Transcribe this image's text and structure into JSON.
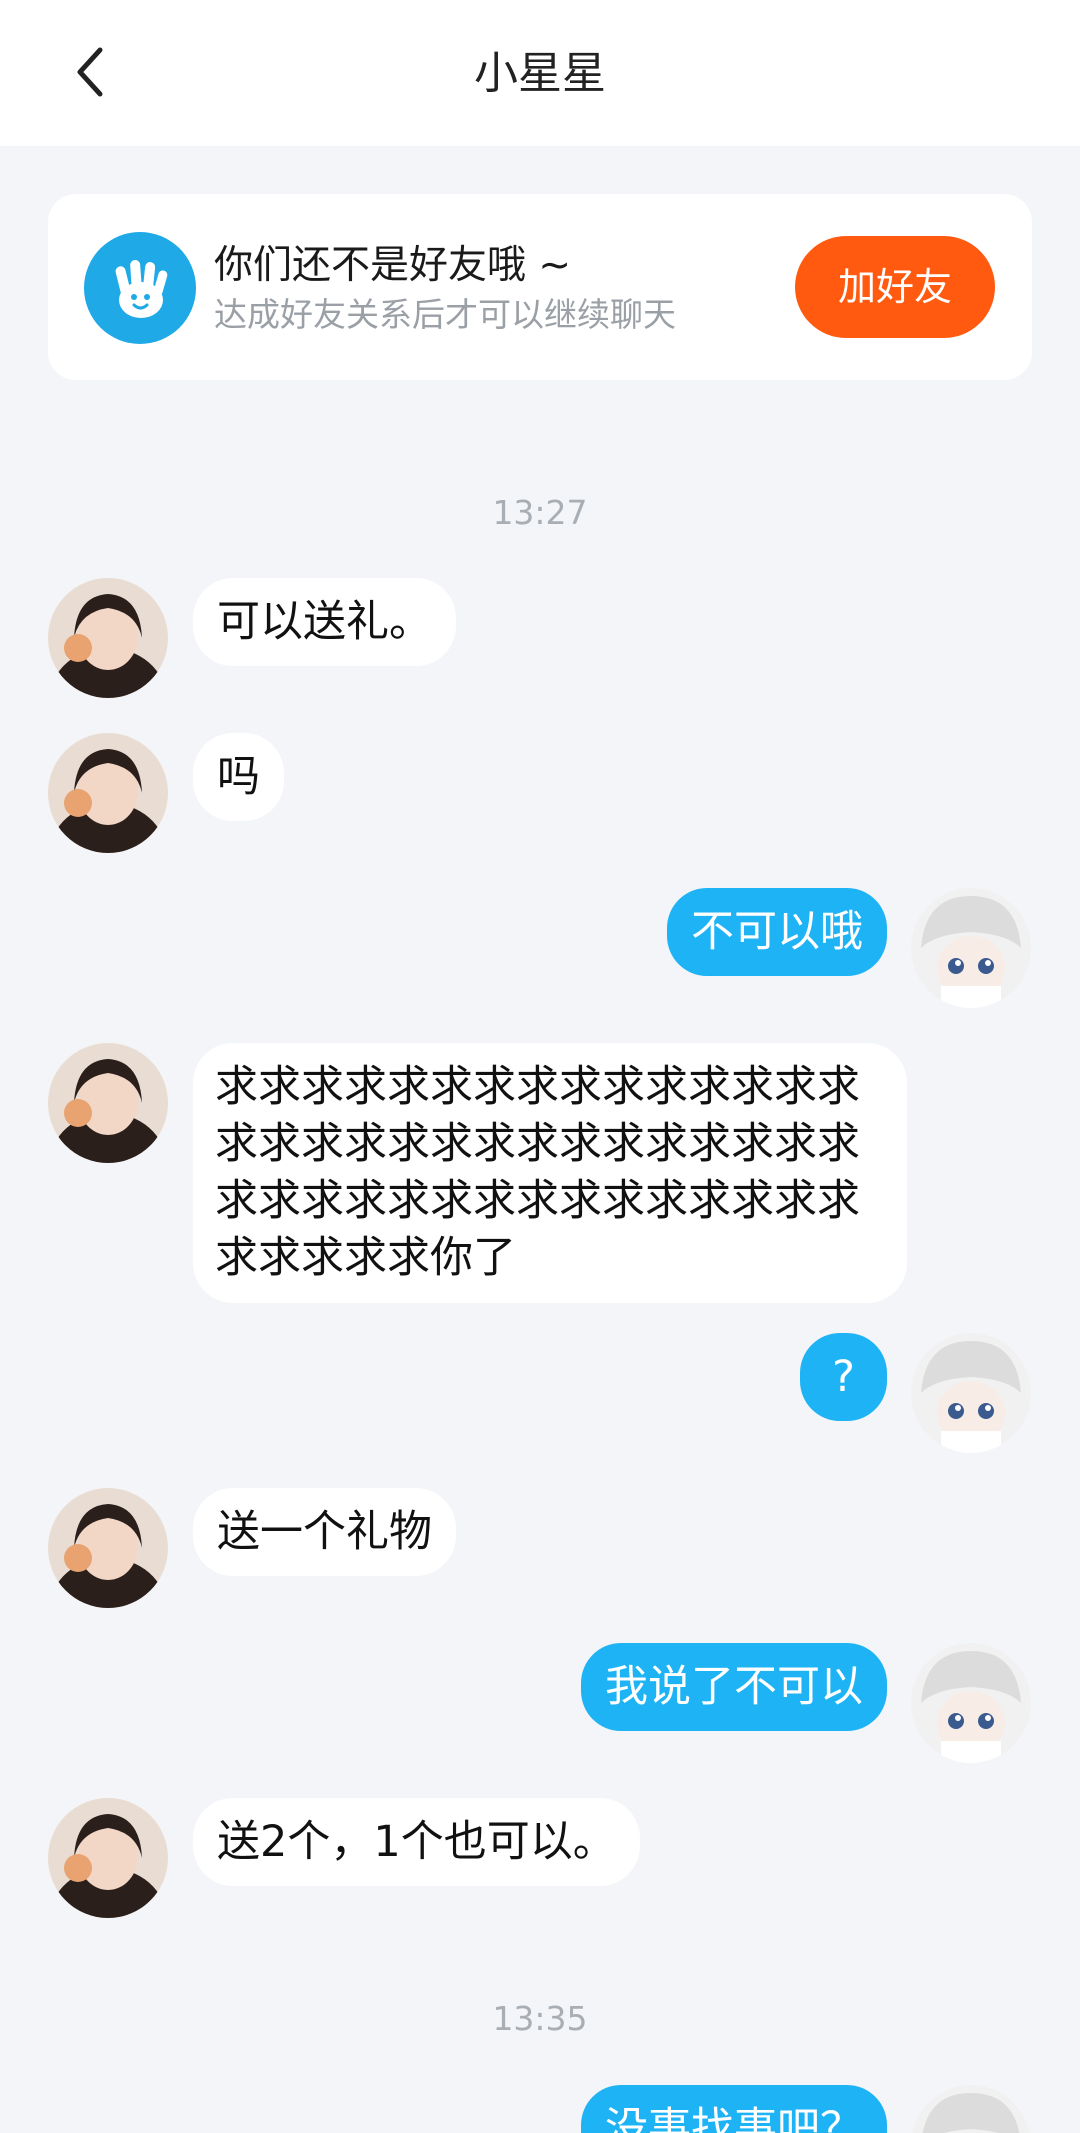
{
  "header": {
    "title": "小星星"
  },
  "banner": {
    "title": "你们还不是好友哦 ~",
    "subtitle": "达成好友关系后才可以继续聊天",
    "add_button": "加好友"
  },
  "timestamps": [
    "13:27",
    "13:35"
  ],
  "messages": [
    {
      "side": "left",
      "text": "可以送礼。"
    },
    {
      "side": "left",
      "text": "吗"
    },
    {
      "side": "right",
      "text": "不可以哦"
    },
    {
      "side": "left",
      "text": "求求求求求求求求求求求求求求求求求求求求求求求求求求求求求求求求求求求求求求求求求求求求求求求求求求你了"
    },
    {
      "side": "right",
      "text": "?"
    },
    {
      "side": "left",
      "text": "送一个礼物"
    },
    {
      "side": "right",
      "text": "我说了不可以"
    },
    {
      "side": "left",
      "text": "送2个，1个也可以。"
    },
    {
      "side": "right",
      "text": "没事找事吧？"
    }
  ],
  "colors": {
    "accent": "#1eb3f5",
    "add_button": "#ff5a10",
    "banner_icon": "#1fa9e6",
    "background": "#f3f5f8"
  },
  "icons": {
    "back": "chevron-left-icon",
    "banner": "waving-hand-icon"
  }
}
